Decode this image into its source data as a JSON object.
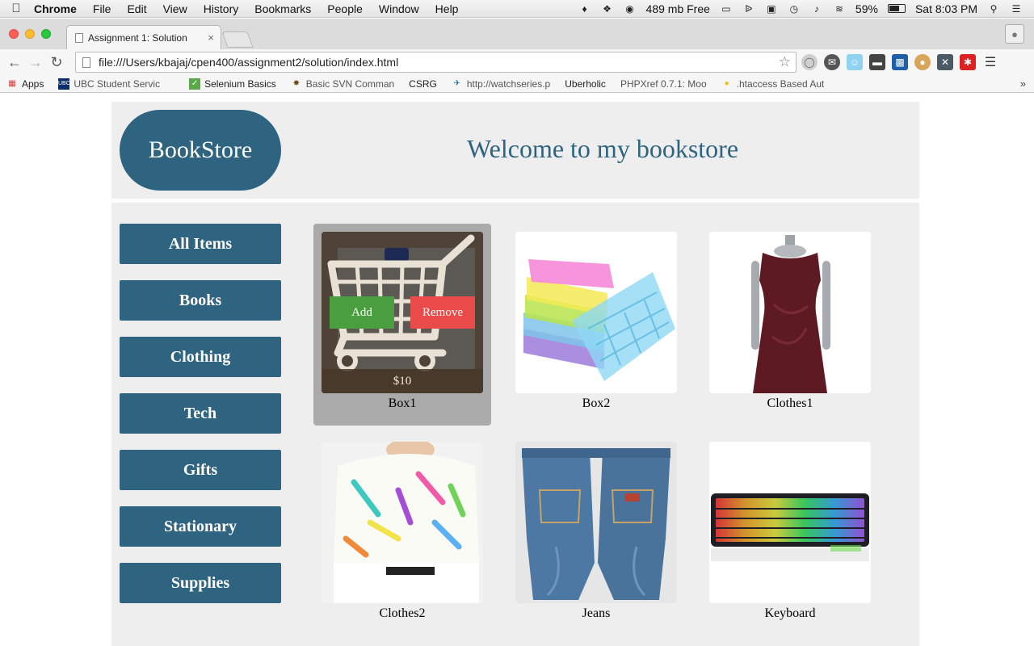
{
  "menubar": {
    "app_name": "Chrome",
    "items": [
      "File",
      "Edit",
      "View",
      "History",
      "Bookmarks",
      "People",
      "Window",
      "Help"
    ],
    "memory": "489 mb Free",
    "battery": "59%",
    "clock": "Sat 8:03 PM"
  },
  "browser": {
    "tab_title": "Assignment 1: Solution",
    "tab_close": "×",
    "url": "file:///Users/kbajaj/cpen400/assignment2/solution/index.html",
    "bookmarks": [
      {
        "label": "Apps",
        "icon": "apps-grid-icon"
      },
      {
        "label": "UBC Student Servic",
        "icon": "ubc-icon"
      },
      {
        "label": "",
        "icon": "page-icon"
      },
      {
        "label": "Selenium Basics",
        "icon": "checkbox-icon"
      },
      {
        "label": "Basic SVN Comman",
        "icon": "svn-icon"
      },
      {
        "label": "CSRG",
        "icon": "page-icon"
      },
      {
        "label": "http://watchseries.p",
        "icon": "watchseries-icon"
      },
      {
        "label": "Uberholic",
        "icon": "page-icon"
      },
      {
        "label": "PHPXref 0.7.1: Moo",
        "icon": "page-icon"
      },
      {
        "label": ".htaccess Based Aut",
        "icon": "lightbulb-icon"
      }
    ],
    "more": "»"
  },
  "site": {
    "logo": "BookStore",
    "welcome": "Welcome to my bookstore"
  },
  "nav": {
    "items": [
      "All Items",
      "Books",
      "Clothing",
      "Tech",
      "Gifts",
      "Stationary",
      "Supplies"
    ]
  },
  "products": [
    {
      "name": "Box1",
      "price": "$10",
      "add_label": "Add",
      "remove_label": "Remove"
    },
    {
      "name": "Box2"
    },
    {
      "name": "Clothes1"
    },
    {
      "name": "Clothes2"
    },
    {
      "name": "Jeans"
    },
    {
      "name": "Keyboard"
    }
  ],
  "colors": {
    "brand": "#2e6480",
    "panel": "#eeeeee",
    "add": "#4a9e3f",
    "remove": "#e94a4a"
  }
}
